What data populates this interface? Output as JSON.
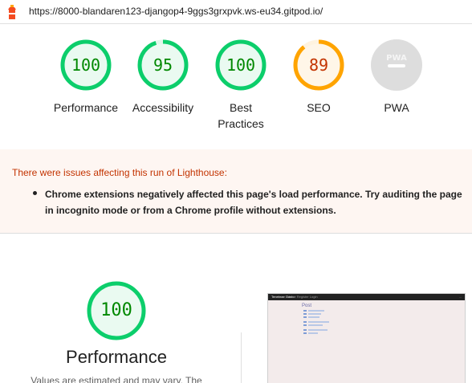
{
  "topbar": {
    "url": "https://8000-blandaren123-djangop4-9ggs3grxpvk.ws-eu34.gitpod.io/",
    "logo_icon": "lighthouse-icon"
  },
  "categories": [
    {
      "label": "Performance",
      "score": "100",
      "status": "pass",
      "color": "#0cce6b",
      "fraction": 1.0
    },
    {
      "label": "Accessibility",
      "score": "95",
      "status": "pass",
      "color": "#0cce6b",
      "fraction": 0.95
    },
    {
      "label": "Best Practices",
      "score": "100",
      "status": "pass",
      "color": "#0cce6b",
      "fraction": 1.0
    },
    {
      "label": "SEO",
      "score": "89",
      "status": "average",
      "color": "#ffa400",
      "fraction": 0.89
    },
    {
      "label": "PWA",
      "score": "",
      "status": "pwa",
      "color": "#dddddd",
      "badge": "PWA"
    }
  ],
  "warnings": {
    "title": "There were issues affecting this run of Lighthouse:",
    "items": [
      "Chrome extensions negatively affected this page's load performance. Try auditing the page in incognito mode or from a Chrome profile without extensions."
    ]
  },
  "performance": {
    "score": "100",
    "fraction": 1.0,
    "title": "Performance",
    "subtitle": "Values are estimated and may vary. The"
  },
  "screenshot": {
    "brand": "Tenebrae Gusto",
    "nav_links": "Home  Register  Login",
    "nav_right": "...",
    "heading": "Post"
  },
  "colors": {
    "pass": "#0cce6b",
    "pass_text": "#008800",
    "average": "#ffa400",
    "average_text": "#C33300",
    "warning_bg": "#fef6f2"
  }
}
